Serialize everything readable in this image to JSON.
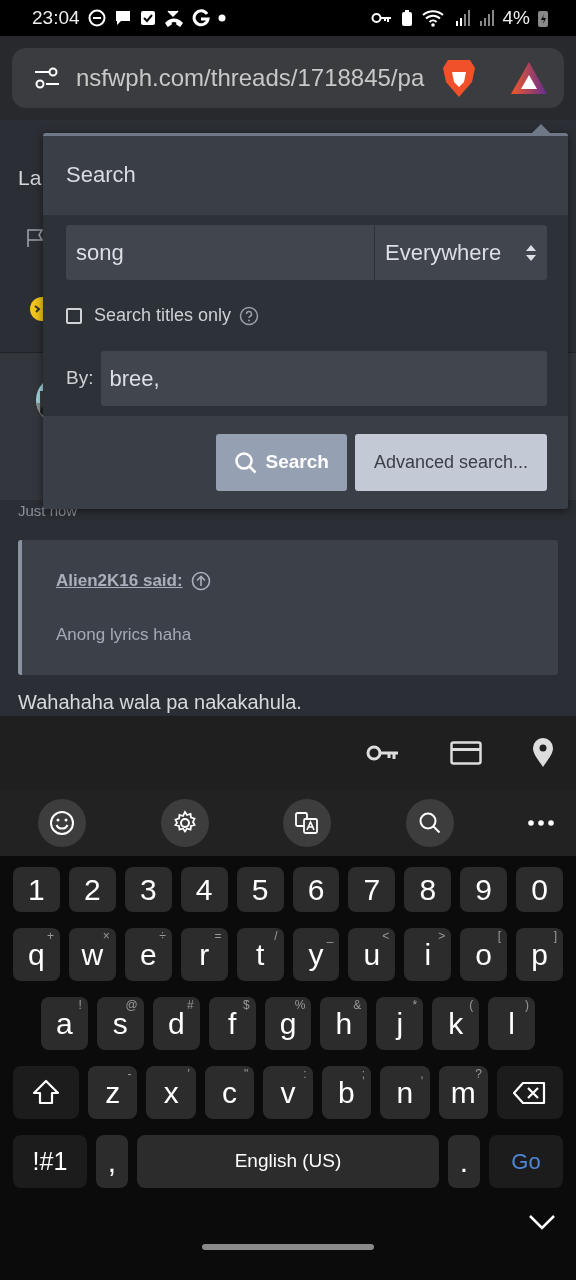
{
  "status_bar": {
    "time": "23:04",
    "battery": "4%"
  },
  "address_bar": {
    "url": "nsfwph.com/threads/1718845/pa"
  },
  "page": {
    "partial_text": "La",
    "post": {
      "time": "Just now",
      "quote": {
        "author": "Alien2K16 said:",
        "text": "Anong lyrics haha"
      },
      "body": "Wahahaha wala pa nakakahula."
    }
  },
  "search_popup": {
    "title": "Search",
    "query": {
      "value": "song"
    },
    "scope": {
      "value": "Everywhere"
    },
    "titles_only": {
      "label": "Search titles only",
      "checked": false
    },
    "by": {
      "label": "By:",
      "value": "bree,"
    },
    "buttons": [
      {
        "label": "Search",
        "kind": "primary"
      },
      {
        "label": "Advanced search...",
        "kind": "secondary"
      }
    ]
  },
  "keyboard": {
    "rows": [
      {
        "keys": [
          {
            "kind": "char",
            "label": "1"
          },
          {
            "kind": "char",
            "label": "2"
          },
          {
            "kind": "char",
            "label": "3"
          },
          {
            "kind": "char",
            "label": "4"
          },
          {
            "kind": "char",
            "label": "5"
          },
          {
            "kind": "char",
            "label": "6"
          },
          {
            "kind": "char",
            "label": "7"
          },
          {
            "kind": "char",
            "label": "8"
          },
          {
            "kind": "char",
            "label": "9"
          },
          {
            "kind": "char",
            "label": "0"
          }
        ]
      },
      {
        "keys": [
          {
            "kind": "char",
            "label": "q",
            "hint": "+"
          },
          {
            "kind": "char",
            "label": "w",
            "hint": "×"
          },
          {
            "kind": "char",
            "label": "e",
            "hint": "÷"
          },
          {
            "kind": "char",
            "label": "r",
            "hint": "="
          },
          {
            "kind": "char",
            "label": "t",
            "hint": "/"
          },
          {
            "kind": "char",
            "label": "y",
            "hint": "_"
          },
          {
            "kind": "char",
            "label": "u",
            "hint": "<"
          },
          {
            "kind": "char",
            "label": "i",
            "hint": ">"
          },
          {
            "kind": "char",
            "label": "o",
            "hint": "["
          },
          {
            "kind": "char",
            "label": "p",
            "hint": "]"
          }
        ]
      },
      {
        "keys": [
          {
            "kind": "char",
            "label": "a",
            "hint": "!"
          },
          {
            "kind": "char",
            "label": "s",
            "hint": "@"
          },
          {
            "kind": "char",
            "label": "d",
            "hint": "#"
          },
          {
            "kind": "char",
            "label": "f",
            "hint": "$"
          },
          {
            "kind": "char",
            "label": "g",
            "hint": "%"
          },
          {
            "kind": "char",
            "label": "h",
            "hint": "&"
          },
          {
            "kind": "char",
            "label": "j",
            "hint": "*"
          },
          {
            "kind": "char",
            "label": "k",
            "hint": "("
          },
          {
            "kind": "char",
            "label": "l",
            "hint": ")"
          }
        ]
      },
      {
        "keys": [
          {
            "kind": "shift"
          },
          {
            "kind": "char",
            "label": "z",
            "hint": "-"
          },
          {
            "kind": "char",
            "label": "x",
            "hint": "'"
          },
          {
            "kind": "char",
            "label": "c",
            "hint": "\""
          },
          {
            "kind": "char",
            "label": "v",
            "hint": ":"
          },
          {
            "kind": "char",
            "label": "b",
            "hint": ";"
          },
          {
            "kind": "char",
            "label": "n",
            "hint": ","
          },
          {
            "kind": "char",
            "label": "m",
            "hint": "?"
          },
          {
            "kind": "backspace"
          }
        ]
      },
      {
        "keys": [
          {
            "kind": "symbols",
            "label": "!#1"
          },
          {
            "kind": "char",
            "label": ","
          },
          {
            "kind": "space",
            "label": "English (US)"
          },
          {
            "kind": "char",
            "label": "."
          },
          {
            "kind": "go",
            "label": "Go"
          }
        ]
      }
    ]
  }
}
